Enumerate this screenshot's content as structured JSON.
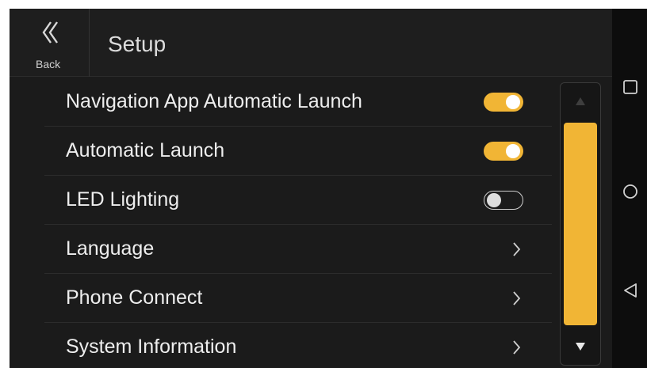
{
  "header": {
    "back_label": "Back",
    "title": "Setup"
  },
  "settings": [
    {
      "label": "Navigation App Automatic Launch",
      "control": "toggle",
      "on": true
    },
    {
      "label": "Automatic Launch",
      "control": "toggle",
      "on": true
    },
    {
      "label": "LED Lighting",
      "control": "toggle",
      "on": false
    },
    {
      "label": "Language",
      "control": "chevron"
    },
    {
      "label": "Phone Connect",
      "control": "chevron"
    },
    {
      "label": "System Information",
      "control": "chevron"
    }
  ],
  "icons": {
    "back": "double-chevron-left-icon",
    "scroll_up": "triangle-up-icon",
    "scroll_down": "triangle-down-icon",
    "nav_recents": "square-icon",
    "nav_home": "circle-icon",
    "nav_back": "triangle-left-icon"
  },
  "colors": {
    "accent": "#f1b535",
    "background": "#1b1b1b",
    "text": "#eeeeee"
  }
}
